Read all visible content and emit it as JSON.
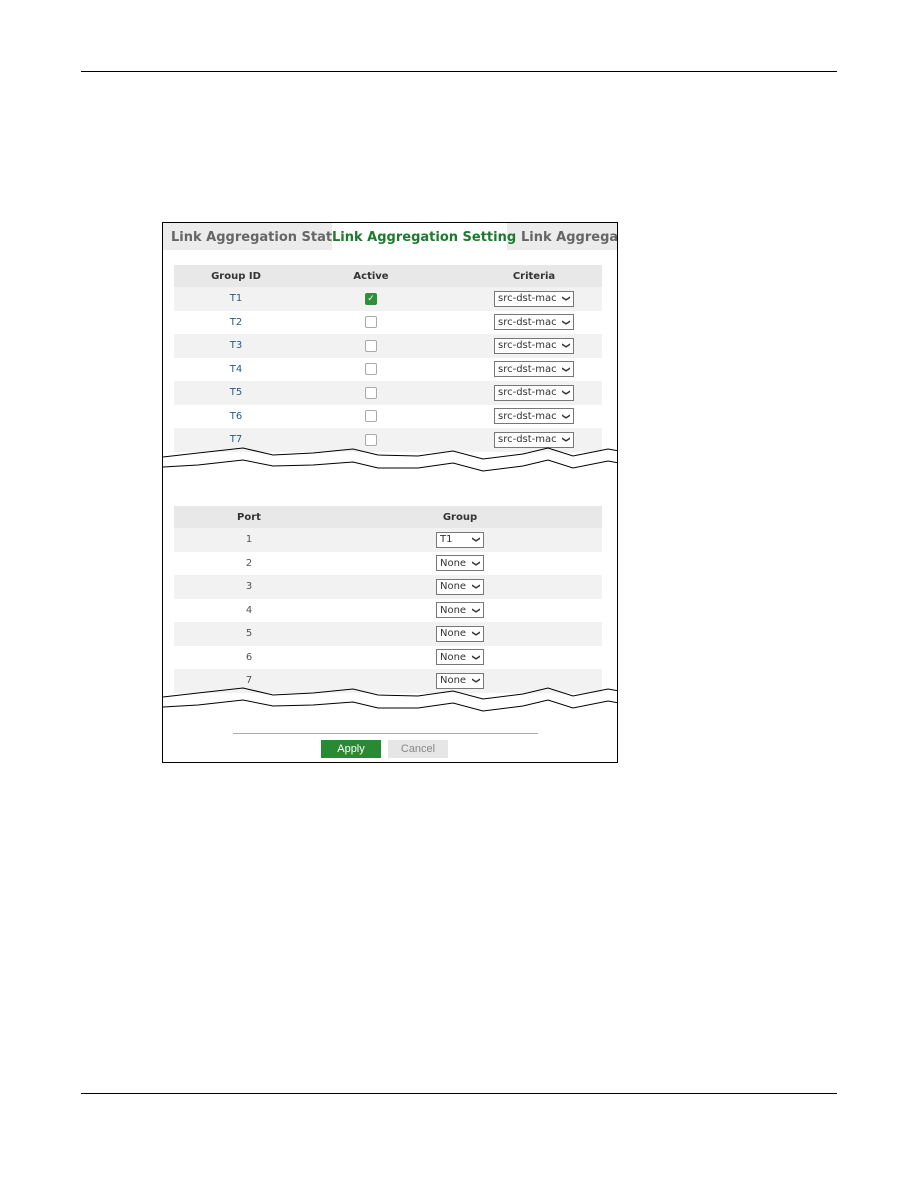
{
  "tabs": [
    {
      "label": "Link Aggregation Status",
      "active": false
    },
    {
      "label": "Link Aggregation Setting",
      "active": true
    },
    {
      "label": "Link Aggregatio",
      "active": false
    }
  ],
  "group_table": {
    "headers": [
      "Group ID",
      "Active",
      "Criteria"
    ],
    "rows": [
      {
        "group_id": "T1",
        "active": true,
        "criteria": "src-dst-mac"
      },
      {
        "group_id": "T2",
        "active": false,
        "criteria": "src-dst-mac"
      },
      {
        "group_id": "T3",
        "active": false,
        "criteria": "src-dst-mac"
      },
      {
        "group_id": "T4",
        "active": false,
        "criteria": "src-dst-mac"
      },
      {
        "group_id": "T5",
        "active": false,
        "criteria": "src-dst-mac"
      },
      {
        "group_id": "T6",
        "active": false,
        "criteria": "src-dst-mac"
      },
      {
        "group_id": "T7",
        "active": false,
        "criteria": "src-dst-mac"
      }
    ]
  },
  "port_table": {
    "headers": [
      "Port",
      "Group"
    ],
    "rows": [
      {
        "port": "1",
        "group": "T1"
      },
      {
        "port": "2",
        "group": "None"
      },
      {
        "port": "3",
        "group": "None"
      },
      {
        "port": "4",
        "group": "None"
      },
      {
        "port": "5",
        "group": "None"
      },
      {
        "port": "6",
        "group": "None"
      },
      {
        "port": "7",
        "group": "None"
      }
    ]
  },
  "buttons": {
    "apply": "Apply",
    "cancel": "Cancel"
  },
  "icons": {
    "chevron": "⌄",
    "check": "✓"
  }
}
